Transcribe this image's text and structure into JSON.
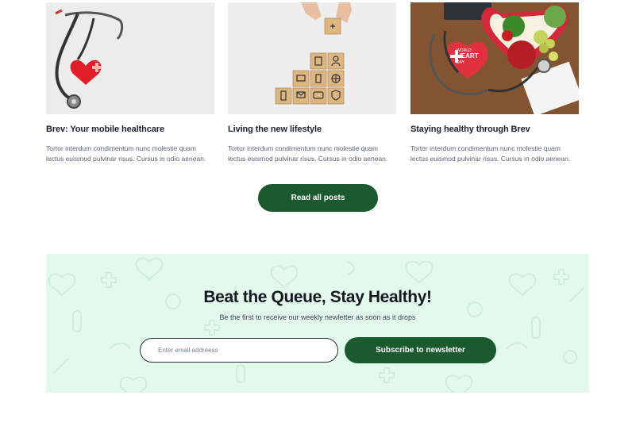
{
  "posts": [
    {
      "image_icon": "stethoscope-heart-image",
      "title": "Brev: Your mobile healthcare",
      "excerpt": "Tortor interdum condimentum nunc molestie quam lectus euismod pulvinar risus. Cursus in odio aenean."
    },
    {
      "image_icon": "wooden-blocks-image",
      "title": "Living the new lifestyle",
      "excerpt": "Tortor interdum condimentum nunc molestie quam lectus euismod pulvinar risus. Cursus in odio aenean."
    },
    {
      "image_icon": "world-heart-day-image",
      "title": "Staying healthy through Brev",
      "excerpt": "Tortor interdum condimentum nunc molestie quam lectus euismod pulvinar risus. Cursus in odio aenean.",
      "image_text": [
        "WORLD",
        "HEART",
        "DAY"
      ]
    }
  ],
  "read_all_label": "Read all posts",
  "newsletter": {
    "title": "Beat the Queue, Stay Healthy!",
    "subtitle": "Be the first to receive our weekly newletter as soon as it drops",
    "email_placeholder": "Enter email addreess",
    "subscribe_label": "Subscribe to newsletter"
  },
  "colors": {
    "brand_green": "#1b5a2f",
    "newsletter_bg": "#e3f9ec",
    "heading": "#151821"
  }
}
